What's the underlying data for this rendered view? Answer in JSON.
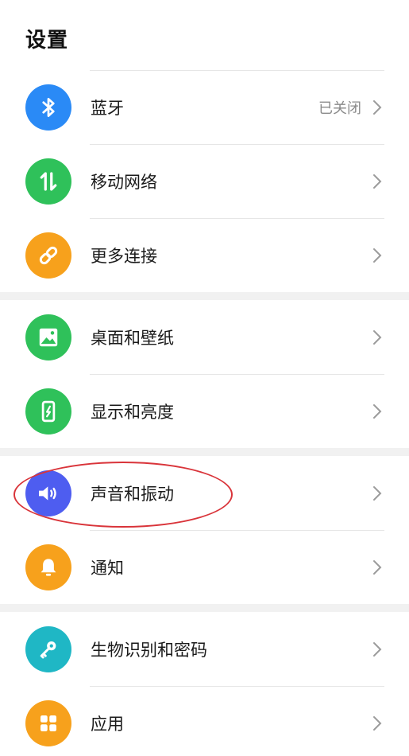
{
  "header": {
    "title": "设置"
  },
  "groups": [
    {
      "items": [
        {
          "name": "bluetooth",
          "label": "蓝牙",
          "value": "已关闭",
          "icon": "bluetooth-icon",
          "color": "#2a8af6"
        },
        {
          "name": "mobile-network",
          "label": "移动网络",
          "icon": "data-transfer-icon",
          "color": "#2fc15a"
        },
        {
          "name": "more-connections",
          "label": "更多连接",
          "icon": "link-icon",
          "color": "#f7a11c"
        }
      ]
    },
    {
      "items": [
        {
          "name": "desktop-wallpaper",
          "label": "桌面和壁纸",
          "icon": "image-icon",
          "color": "#2fc15a"
        },
        {
          "name": "display-brightness",
          "label": "显示和亮度",
          "icon": "phone-display-icon",
          "color": "#2fc15a"
        }
      ]
    },
    {
      "items": [
        {
          "name": "sound-vibration",
          "label": "声音和振动",
          "icon": "speaker-icon",
          "color": "#4e5df0"
        },
        {
          "name": "notifications",
          "label": "通知",
          "icon": "bell-icon",
          "color": "#f7a11c"
        }
      ]
    },
    {
      "items": [
        {
          "name": "biometrics-password",
          "label": "生物识别和密码",
          "icon": "key-icon",
          "color": "#1fb7c5"
        },
        {
          "name": "apps",
          "label": "应用",
          "icon": "apps-grid-icon",
          "color": "#f7a11c"
        }
      ]
    }
  ],
  "annotation": {
    "color": "#d9343a",
    "target": "sound-vibration"
  }
}
